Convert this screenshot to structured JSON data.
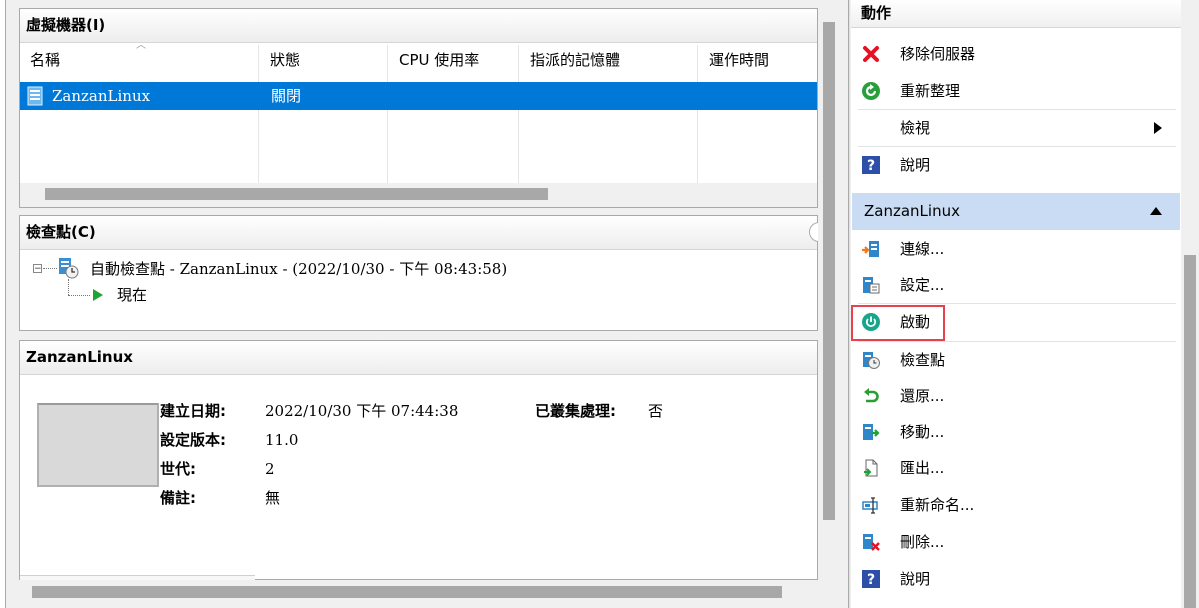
{
  "vm_panel": {
    "title": "虛擬機器(I)",
    "columns": [
      "名稱",
      "狀態",
      "CPU 使用率",
      "指派的記憶體",
      "運作時間"
    ],
    "rows": [
      {
        "name": "ZanzanLinux",
        "state": "關閉",
        "cpu": "",
        "memory": "",
        "uptime": ""
      }
    ]
  },
  "checkpoint_panel": {
    "title": "檢查點(C)",
    "checkpoint": "自動檢查點 - ZanzanLinux - (2022/10/30 - 下午 08:43:58)",
    "now": "現在"
  },
  "detail_panel": {
    "title": "ZanzanLinux",
    "created_label": "建立日期:",
    "created_value": "2022/10/30 下午 07:44:38",
    "config_label": "設定版本:",
    "config_value": "11.0",
    "generation_label": "世代:",
    "generation_value": "2",
    "notes_label": "備註:",
    "notes_value": "無",
    "clustered_label": "已叢集處理:",
    "clustered_value": "否"
  },
  "actions": {
    "title": "動作",
    "server_items": [
      {
        "label": "移除伺服器",
        "icon": "red-x-icon"
      },
      {
        "label": "重新整理",
        "icon": "refresh-icon"
      },
      {
        "label": "檢視",
        "icon": "none"
      },
      {
        "label": "說明",
        "icon": "help-icon"
      }
    ],
    "vm_section_title": "ZanzanLinux",
    "vm_items": [
      {
        "label": "連線...",
        "icon": "connect-icon"
      },
      {
        "label": "設定...",
        "icon": "settings-icon"
      },
      {
        "label": "啟動",
        "icon": "power-start-icon"
      },
      {
        "label": "檢查點",
        "icon": "checkpoint-icon"
      },
      {
        "label": "還原...",
        "icon": "revert-icon"
      },
      {
        "label": "移動...",
        "icon": "move-icon"
      },
      {
        "label": "匯出...",
        "icon": "export-icon"
      },
      {
        "label": "重新命名...",
        "icon": "rename-icon"
      },
      {
        "label": "刪除...",
        "icon": "delete-icon"
      },
      {
        "label": "說明",
        "icon": "help-icon"
      }
    ]
  },
  "colors": {
    "selection": "#0078d7",
    "highlight_box": "#e81123",
    "section_header": "#c9dcf3"
  }
}
